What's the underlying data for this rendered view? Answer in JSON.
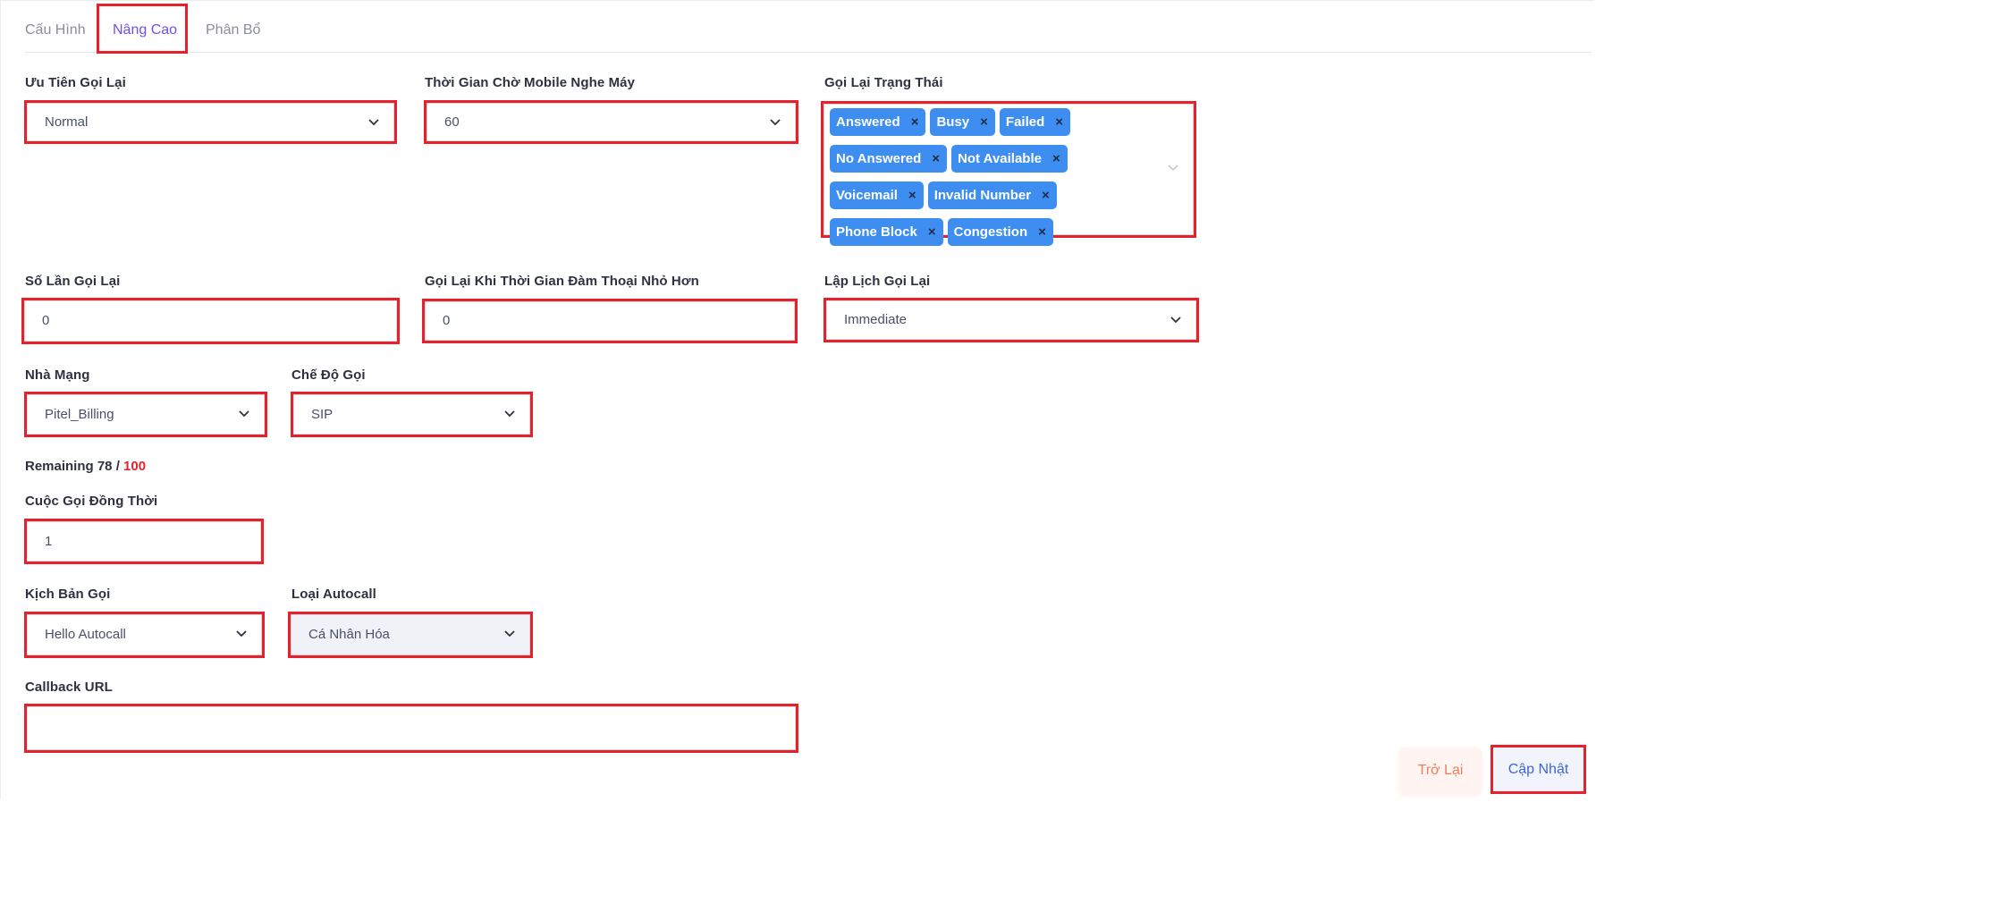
{
  "tabs": [
    {
      "label": "Cấu Hình",
      "active": false
    },
    {
      "label": "Nâng Cao",
      "active": true
    },
    {
      "label": "Phân Bổ",
      "active": false
    }
  ],
  "fields": {
    "callback_priority": {
      "label": "Ưu Tiên Gọi Lại",
      "value": "Normal"
    },
    "mobile_wait_time": {
      "label": "Thời Gian Chờ Mobile Nghe Máy",
      "value": "60"
    },
    "callback_status": {
      "label": "Gọi Lại Trạng Thái",
      "tags": [
        "Answered",
        "Busy",
        "Failed",
        "No Answered",
        "Not Available",
        "Voicemail",
        "Invalid Number",
        "Phone Block",
        "Congestion"
      ],
      "remove_glyph": "×"
    },
    "callback_count": {
      "label": "Số Lần Gọi Lại",
      "value": "0"
    },
    "callback_min_talk": {
      "label": "Gọi Lại Khi Thời Gian Đàm Thoại Nhỏ Hơn",
      "value": "0"
    },
    "callback_schedule": {
      "label": "Lập Lịch Gọi Lại",
      "value": "Immediate"
    },
    "carrier": {
      "label": "Nhà Mạng",
      "value": "Pitel_Billing"
    },
    "call_mode": {
      "label": "Chế Độ Gọi",
      "value": "SIP"
    },
    "concurrent_calls": {
      "label": "Cuộc Gọi Đồng Thời",
      "value": "1"
    },
    "call_script": {
      "label": "Kịch Bản Gọi",
      "value": "Hello Autocall"
    },
    "autocall_type": {
      "label": "Loại Autocall",
      "value": "Cá Nhân Hóa"
    },
    "callback_url": {
      "label": "Callback URL",
      "value": ""
    }
  },
  "remaining": {
    "prefix": "Remaining 78 / ",
    "max": "100"
  },
  "buttons": {
    "back": "Trở Lại",
    "update": "Cập Nhật"
  },
  "colors": {
    "accent": "#6a52f0",
    "tag": "#3d8ef0",
    "highlight": "#e8202a",
    "back": "#f07f5c",
    "update": "#3d66d6"
  }
}
